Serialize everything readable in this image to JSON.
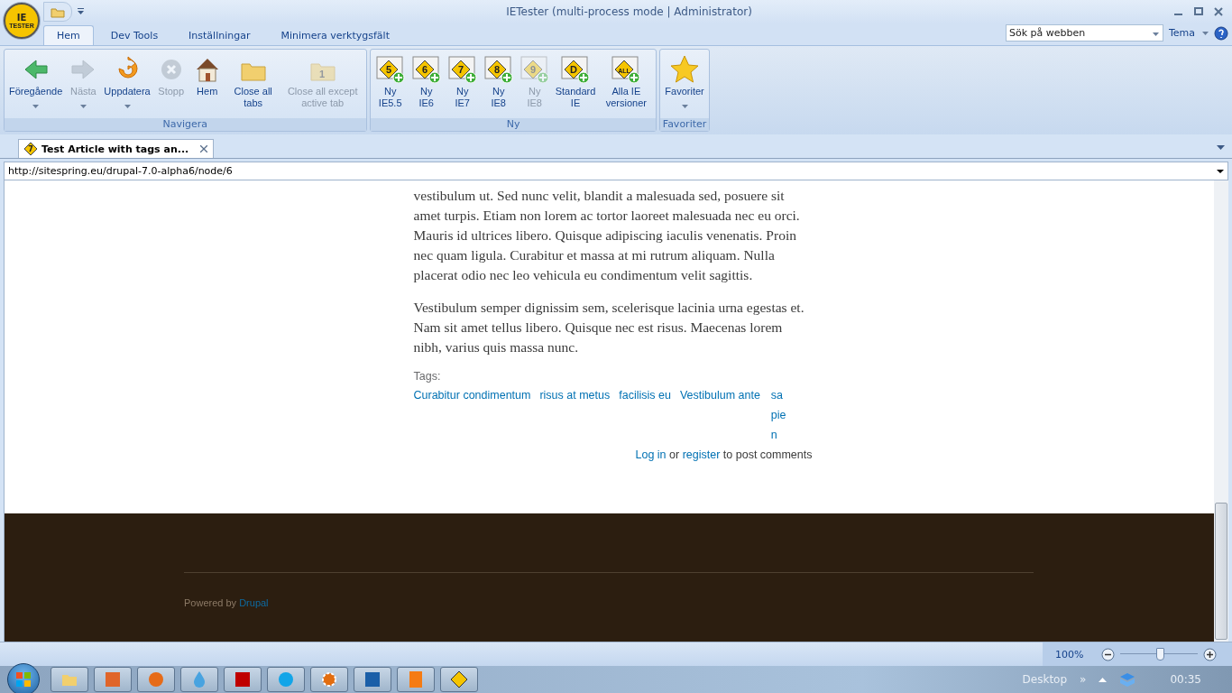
{
  "window": {
    "title": "IETester (multi-process mode | Administrator)"
  },
  "logo": {
    "badge": "IE",
    "text": "TESTER"
  },
  "tabs": [
    {
      "label": "Hem",
      "selected": true
    },
    {
      "label": "Dev Tools",
      "selected": false
    },
    {
      "label": "Inställningar",
      "selected": false
    },
    {
      "label": "Minimera verktygsfält",
      "selected": false
    }
  ],
  "search": {
    "placeholder": "Sök på webben"
  },
  "theme_menu": "Tema",
  "groups": [
    {
      "label": "Navigera",
      "buttons": [
        {
          "kind": "back",
          "label": "Föregående",
          "disabled": false,
          "dropdown": true
        },
        {
          "kind": "forward",
          "label": "Nästa",
          "disabled": true,
          "dropdown": true
        },
        {
          "kind": "refresh",
          "label": "Uppdatera",
          "disabled": false,
          "dropdown": true
        },
        {
          "kind": "stop",
          "label": "Stopp",
          "disabled": true,
          "dropdown": false
        },
        {
          "kind": "home",
          "label": "Hem",
          "disabled": false,
          "dropdown": false
        },
        {
          "kind": "folder",
          "label": "Close all tabs",
          "disabled": false,
          "dropdown": false
        },
        {
          "kind": "folder",
          "label": "Close all except active tab",
          "disabled": true,
          "dropdown": false,
          "badge": "1"
        }
      ]
    },
    {
      "label": "Ny",
      "buttons": [
        {
          "kind": "ie",
          "badge": "5",
          "label": "Ny IE5.5",
          "disabled": false,
          "dropdown": false
        },
        {
          "kind": "ie",
          "badge": "6",
          "label": "Ny IE6",
          "disabled": false,
          "dropdown": false
        },
        {
          "kind": "ie",
          "badge": "7",
          "label": "Ny IE7",
          "disabled": false,
          "dropdown": false
        },
        {
          "kind": "ie",
          "badge": "8",
          "label": "Ny IE8",
          "disabled": false,
          "dropdown": false
        },
        {
          "kind": "ie",
          "badge": "9",
          "label": "Ny IE8",
          "disabled": true,
          "dropdown": false
        },
        {
          "kind": "ie",
          "badge": "D",
          "label": "Standard IE",
          "disabled": false,
          "dropdown": false
        },
        {
          "kind": "ie",
          "badge": "ALL",
          "label": "Alla IE versioner",
          "disabled": false,
          "dropdown": false
        }
      ]
    },
    {
      "label": "Favoriter",
      "buttons": [
        {
          "kind": "star",
          "label": "Favoriter",
          "disabled": false,
          "dropdown": true
        }
      ]
    }
  ],
  "page_tabs": [
    {
      "title": "Test Article with tags an...",
      "badge": "7",
      "selected": true
    }
  ],
  "address": "http://sitespring.eu/drupal-7.0-alpha6/node/6",
  "article": {
    "paragraphs": [
      "vestibulum ut. Sed nunc velit, blandit a malesuada sed, posuere sit amet turpis. Etiam non lorem ac tortor laoreet malesuada nec eu orci. Mauris id ultrices libero. Quisque adipiscing iaculis venenatis. Proin nec quam ligula. Curabitur et massa at mi rutrum aliquam. Nulla placerat odio nec leo vehicula eu condimentum velit sagittis.",
      "Vestibulum semper dignissim sem, scelerisque lacinia urna egestas et. Nam sit amet tellus libero. Quisque nec est risus. Maecenas lorem nibh, varius quis massa nunc."
    ],
    "tags_label": "Tags:",
    "tags": [
      "Curabitur condimentum",
      "risus at metus",
      "facilisis eu",
      "Vestibulum ante",
      "sapien"
    ],
    "comment": {
      "login": "Log in",
      "or": "or",
      "register": "register",
      "rest": "to post comments"
    }
  },
  "footer": {
    "powered": "Powered by",
    "drupal": "Drupal"
  },
  "status_bar": {
    "zoom": "100%",
    "level": 0.5
  },
  "taskbar": {
    "apps": [
      {
        "kind": "folder"
      },
      {
        "kind": "orange"
      },
      {
        "kind": "firefox"
      },
      {
        "kind": "drop"
      },
      {
        "kind": "filezilla"
      },
      {
        "kind": "skype"
      },
      {
        "kind": "gear"
      },
      {
        "kind": "photoshop"
      },
      {
        "kind": "zero"
      },
      {
        "kind": "ie"
      }
    ],
    "desktop": "Desktop",
    "chevron": "»",
    "clock": "00:35"
  }
}
